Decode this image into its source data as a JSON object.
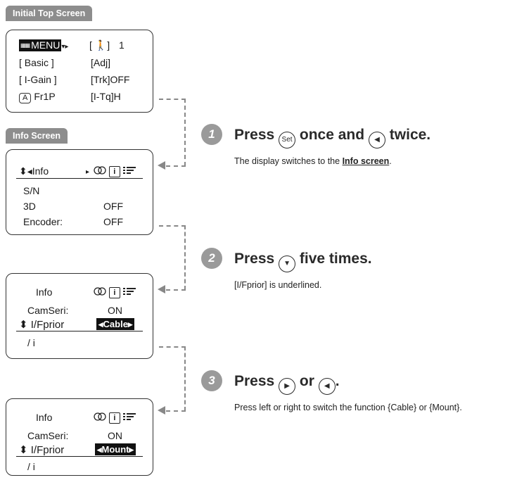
{
  "labels": {
    "initial_top_screen": "Initial Top Screen",
    "info_screen": "Info Screen"
  },
  "top_screen": {
    "menu_badge": "MENU",
    "arrows": "▾▸",
    "person_bracket": "[ 🚶]",
    "number": "1",
    "basic": "[ Basic ]",
    "adj": "[Adj]",
    "igain": "[ I-Gain ]",
    "trk": "[Trk]OFF",
    "a_badge": "A",
    "fr1p": "Fr1P",
    "itq": "[I-Tq]H"
  },
  "info_screen": {
    "nav": "⬍◂Info",
    "nav_right_arrow": "▸",
    "icon_b": "i",
    "sn": "S/N",
    "three_d": "3D",
    "three_d_value": "OFF",
    "encoder": "Encoder:",
    "encoder_value": "OFF"
  },
  "screen3": {
    "title": "Info",
    "icon_b": "i",
    "camseri": "CamSeri:",
    "camseri_value": "ON",
    "ifprior": "⬍ I/Fprior",
    "ifprior_value": "◂Cable▸",
    "slash_i": "/ i"
  },
  "screen4": {
    "title": "Info",
    "icon_b": "i",
    "camseri": "CamSeri:",
    "camseri_value": "ON",
    "ifprior": "⬍ I/Fprior",
    "ifprior_value": "◂Mount▸",
    "slash_i": "/ i"
  },
  "steps": [
    {
      "num": "1",
      "title_before": "Press",
      "button_a": "Set",
      "title_mid": "once and",
      "button_b": "◀",
      "title_after": "twice.",
      "desc_before": "The display switches to the",
      "desc_link": "Info screen",
      "desc_after": "."
    },
    {
      "num": "2",
      "title_before": "Press",
      "button_a": "▼",
      "title_after": "five times.",
      "desc": "[I/Fprior] is underlined."
    },
    {
      "num": "3",
      "title_before": "Press",
      "button_a": "▶",
      "title_mid": "or",
      "button_b": "◀",
      "title_after": ".",
      "desc": "Press left or right to switch the function {Cable} or {Mount}."
    }
  ],
  "colors": {
    "tag_bg": "#8d8d8d",
    "step_circle": "#9a9a9a",
    "connector": "#888888"
  }
}
